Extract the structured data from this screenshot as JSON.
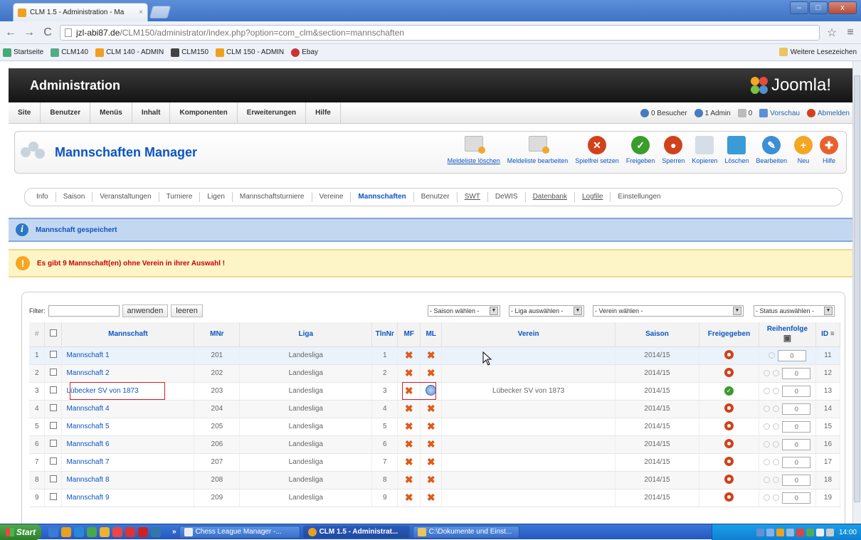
{
  "browser": {
    "tab_title": "CLM 1.5 - Administration - Ma",
    "url_domain": "jzl-abi87.de",
    "url_path": "/CLM150/administrator/index.php?option=com_clm&section=mannschaften",
    "bookmarks": [
      "Startseite",
      "CLM140",
      "CLM 140 - ADMIN",
      "CLM150",
      "CLM 150 - ADMIN",
      "Ebay"
    ],
    "other_bookmarks": "Weitere Lesezeichen"
  },
  "header": {
    "title": "Administration",
    "logo": "Joomla!"
  },
  "menu": {
    "items": [
      "Site",
      "Benutzer",
      "Menüs",
      "Inhalt",
      "Komponenten",
      "Erweiterungen",
      "Hilfe"
    ],
    "visitors": "0 Besucher",
    "admins": "1 Admin",
    "messages": "0",
    "preview": "Vorschau",
    "logout": "Abmelden"
  },
  "toolbar": {
    "title": "Mannschaften Manager",
    "buttons": [
      "Meldeliste löschen",
      "Meldeliste bearbeiten",
      "Spielfrei setzen",
      "Freigeben",
      "Sperren",
      "Kopieren",
      "Löschen",
      "Bearbeiten",
      "Neu",
      "Hilfe"
    ]
  },
  "submenu": {
    "items": [
      "Info",
      "Saison",
      "Veranstaltungen",
      "Turniere",
      "Ligen",
      "Mannschaftsturniere",
      "Vereine",
      "Mannschaften",
      "Benutzer",
      "SWT",
      "DeWIS",
      "Datenbank",
      "Logfile",
      "Einstellungen"
    ]
  },
  "messages": {
    "saved": "Mannschaft gespeichert",
    "warning": "Es gibt 9 Mannschaft(en) ohne Verein in ihrer Auswahl !"
  },
  "filter": {
    "label": "Filter:",
    "apply": "anwenden",
    "clear": "leeren",
    "season": "- Saison wählen -",
    "league": "- Liga auswählen -",
    "club": "- Verein wählen -",
    "status": "- Status auswählen -"
  },
  "table": {
    "headers": [
      "#",
      "Mannschaft",
      "MNr",
      "Liga",
      "TlnNr",
      "MF",
      "ML",
      "Verein",
      "Saison",
      "Freigegeben",
      "Reihenfolge",
      "ID"
    ],
    "rows": [
      {
        "num": "1",
        "name": "Mannschaft 1",
        "mnr": "201",
        "liga": "Landesliga",
        "tln": "1",
        "verein": "",
        "saison": "2014/15",
        "order": "0",
        "id": "11"
      },
      {
        "num": "2",
        "name": "Mannschaft 2",
        "mnr": "202",
        "liga": "Landesliga",
        "tln": "2",
        "verein": "",
        "saison": "2014/15",
        "order": "0",
        "id": "12"
      },
      {
        "num": "3",
        "name": "Lübecker SV von 1873",
        "mnr": "203",
        "liga": "Landesliga",
        "tln": "3",
        "verein": "Lübecker SV von 1873",
        "saison": "2014/15",
        "order": "0",
        "id": "13"
      },
      {
        "num": "4",
        "name": "Mannschaft 4",
        "mnr": "204",
        "liga": "Landesliga",
        "tln": "4",
        "verein": "",
        "saison": "2014/15",
        "order": "0",
        "id": "14"
      },
      {
        "num": "5",
        "name": "Mannschaft 5",
        "mnr": "205",
        "liga": "Landesliga",
        "tln": "5",
        "verein": "",
        "saison": "2014/15",
        "order": "0",
        "id": "15"
      },
      {
        "num": "6",
        "name": "Mannschaft 6",
        "mnr": "206",
        "liga": "Landesliga",
        "tln": "6",
        "verein": "",
        "saison": "2014/15",
        "order": "0",
        "id": "16"
      },
      {
        "num": "7",
        "name": "Mannschaft 7",
        "mnr": "207",
        "liga": "Landesliga",
        "tln": "7",
        "verein": "",
        "saison": "2014/15",
        "order": "0",
        "id": "17"
      },
      {
        "num": "8",
        "name": "Mannschaft 8",
        "mnr": "208",
        "liga": "Landesliga",
        "tln": "8",
        "verein": "",
        "saison": "2014/15",
        "order": "0",
        "id": "18"
      },
      {
        "num": "9",
        "name": "Mannschaft 9",
        "mnr": "209",
        "liga": "Landesliga",
        "tln": "9",
        "verein": "",
        "saison": "2014/15",
        "order": "0",
        "id": "19"
      }
    ]
  },
  "taskbar": {
    "start": "Start",
    "tasks": [
      "Chess League Manager -...",
      "CLM 1.5 - Administrat...",
      "C:\\Dokumente und Einst..."
    ],
    "clock": "14:00"
  }
}
